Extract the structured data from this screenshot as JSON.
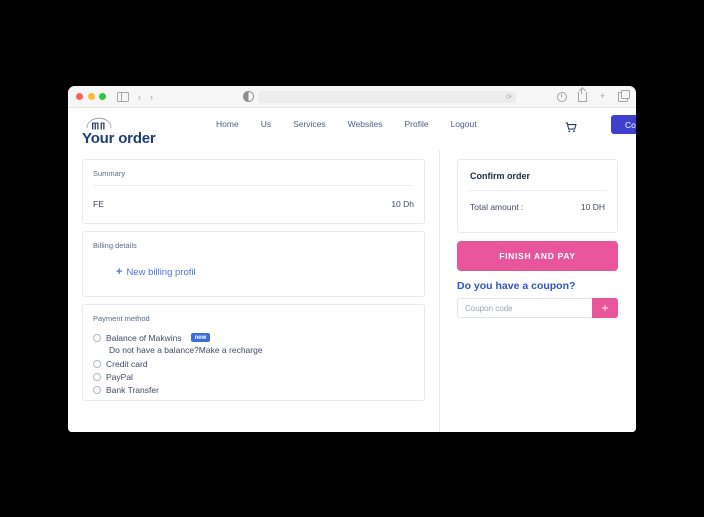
{
  "browser": {
    "traffic_lights": [
      "close",
      "minimize",
      "maximize"
    ],
    "url_value": "",
    "url_placeholder": "",
    "icons": {
      "sidebar": "sidebar-toggle-icon",
      "back": "‹",
      "forward": "›",
      "reader": "reader-mode-icon",
      "reload": "⟳",
      "privacy": "privacy-report-icon",
      "share": "share-icon",
      "new_tab": "+",
      "tab_overview": "tab-overview-icon"
    }
  },
  "site": {
    "logo_alt": "mw",
    "page_title": "Your order",
    "nav": [
      {
        "label": "Home"
      },
      {
        "label": "Us"
      },
      {
        "label": "Services"
      },
      {
        "label": "Websites"
      },
      {
        "label": "Profile"
      },
      {
        "label": "Logout"
      }
    ],
    "cart_icon": "shopping-cart-icon",
    "contact_label": "Contact Us"
  },
  "summary": {
    "label": "Summary",
    "item_name": "FE",
    "item_price": "10 Dh"
  },
  "billing": {
    "label": "Billing details",
    "new_profile_label": "New billing profil",
    "plus": "+"
  },
  "payment": {
    "label": "Payment method",
    "options": [
      {
        "label": "Balance of Makwins",
        "badge": "new"
      },
      {
        "label": "Credit card",
        "badge": ""
      },
      {
        "label": "PayPal",
        "badge": ""
      },
      {
        "label": "Bank Transfer",
        "badge": ""
      }
    ],
    "recharge_note": "Do not have a balance?Make a recharge"
  },
  "confirm": {
    "title": "Confirm order",
    "total_label": "Total amount :",
    "total_value": "10 DH",
    "pay_label": "FINISH AND PAY"
  },
  "coupon": {
    "title": "Do you have a coupon?",
    "placeholder": "Coupon code",
    "value": "",
    "add_label": "+"
  },
  "colors": {
    "accent_pink": "#e8559b",
    "accent_blue": "#3f3fce",
    "link_blue": "#4e74dd",
    "heading_navy": "#1d3f76",
    "badge_blue": "#3d6ddc",
    "background": "#000000"
  }
}
